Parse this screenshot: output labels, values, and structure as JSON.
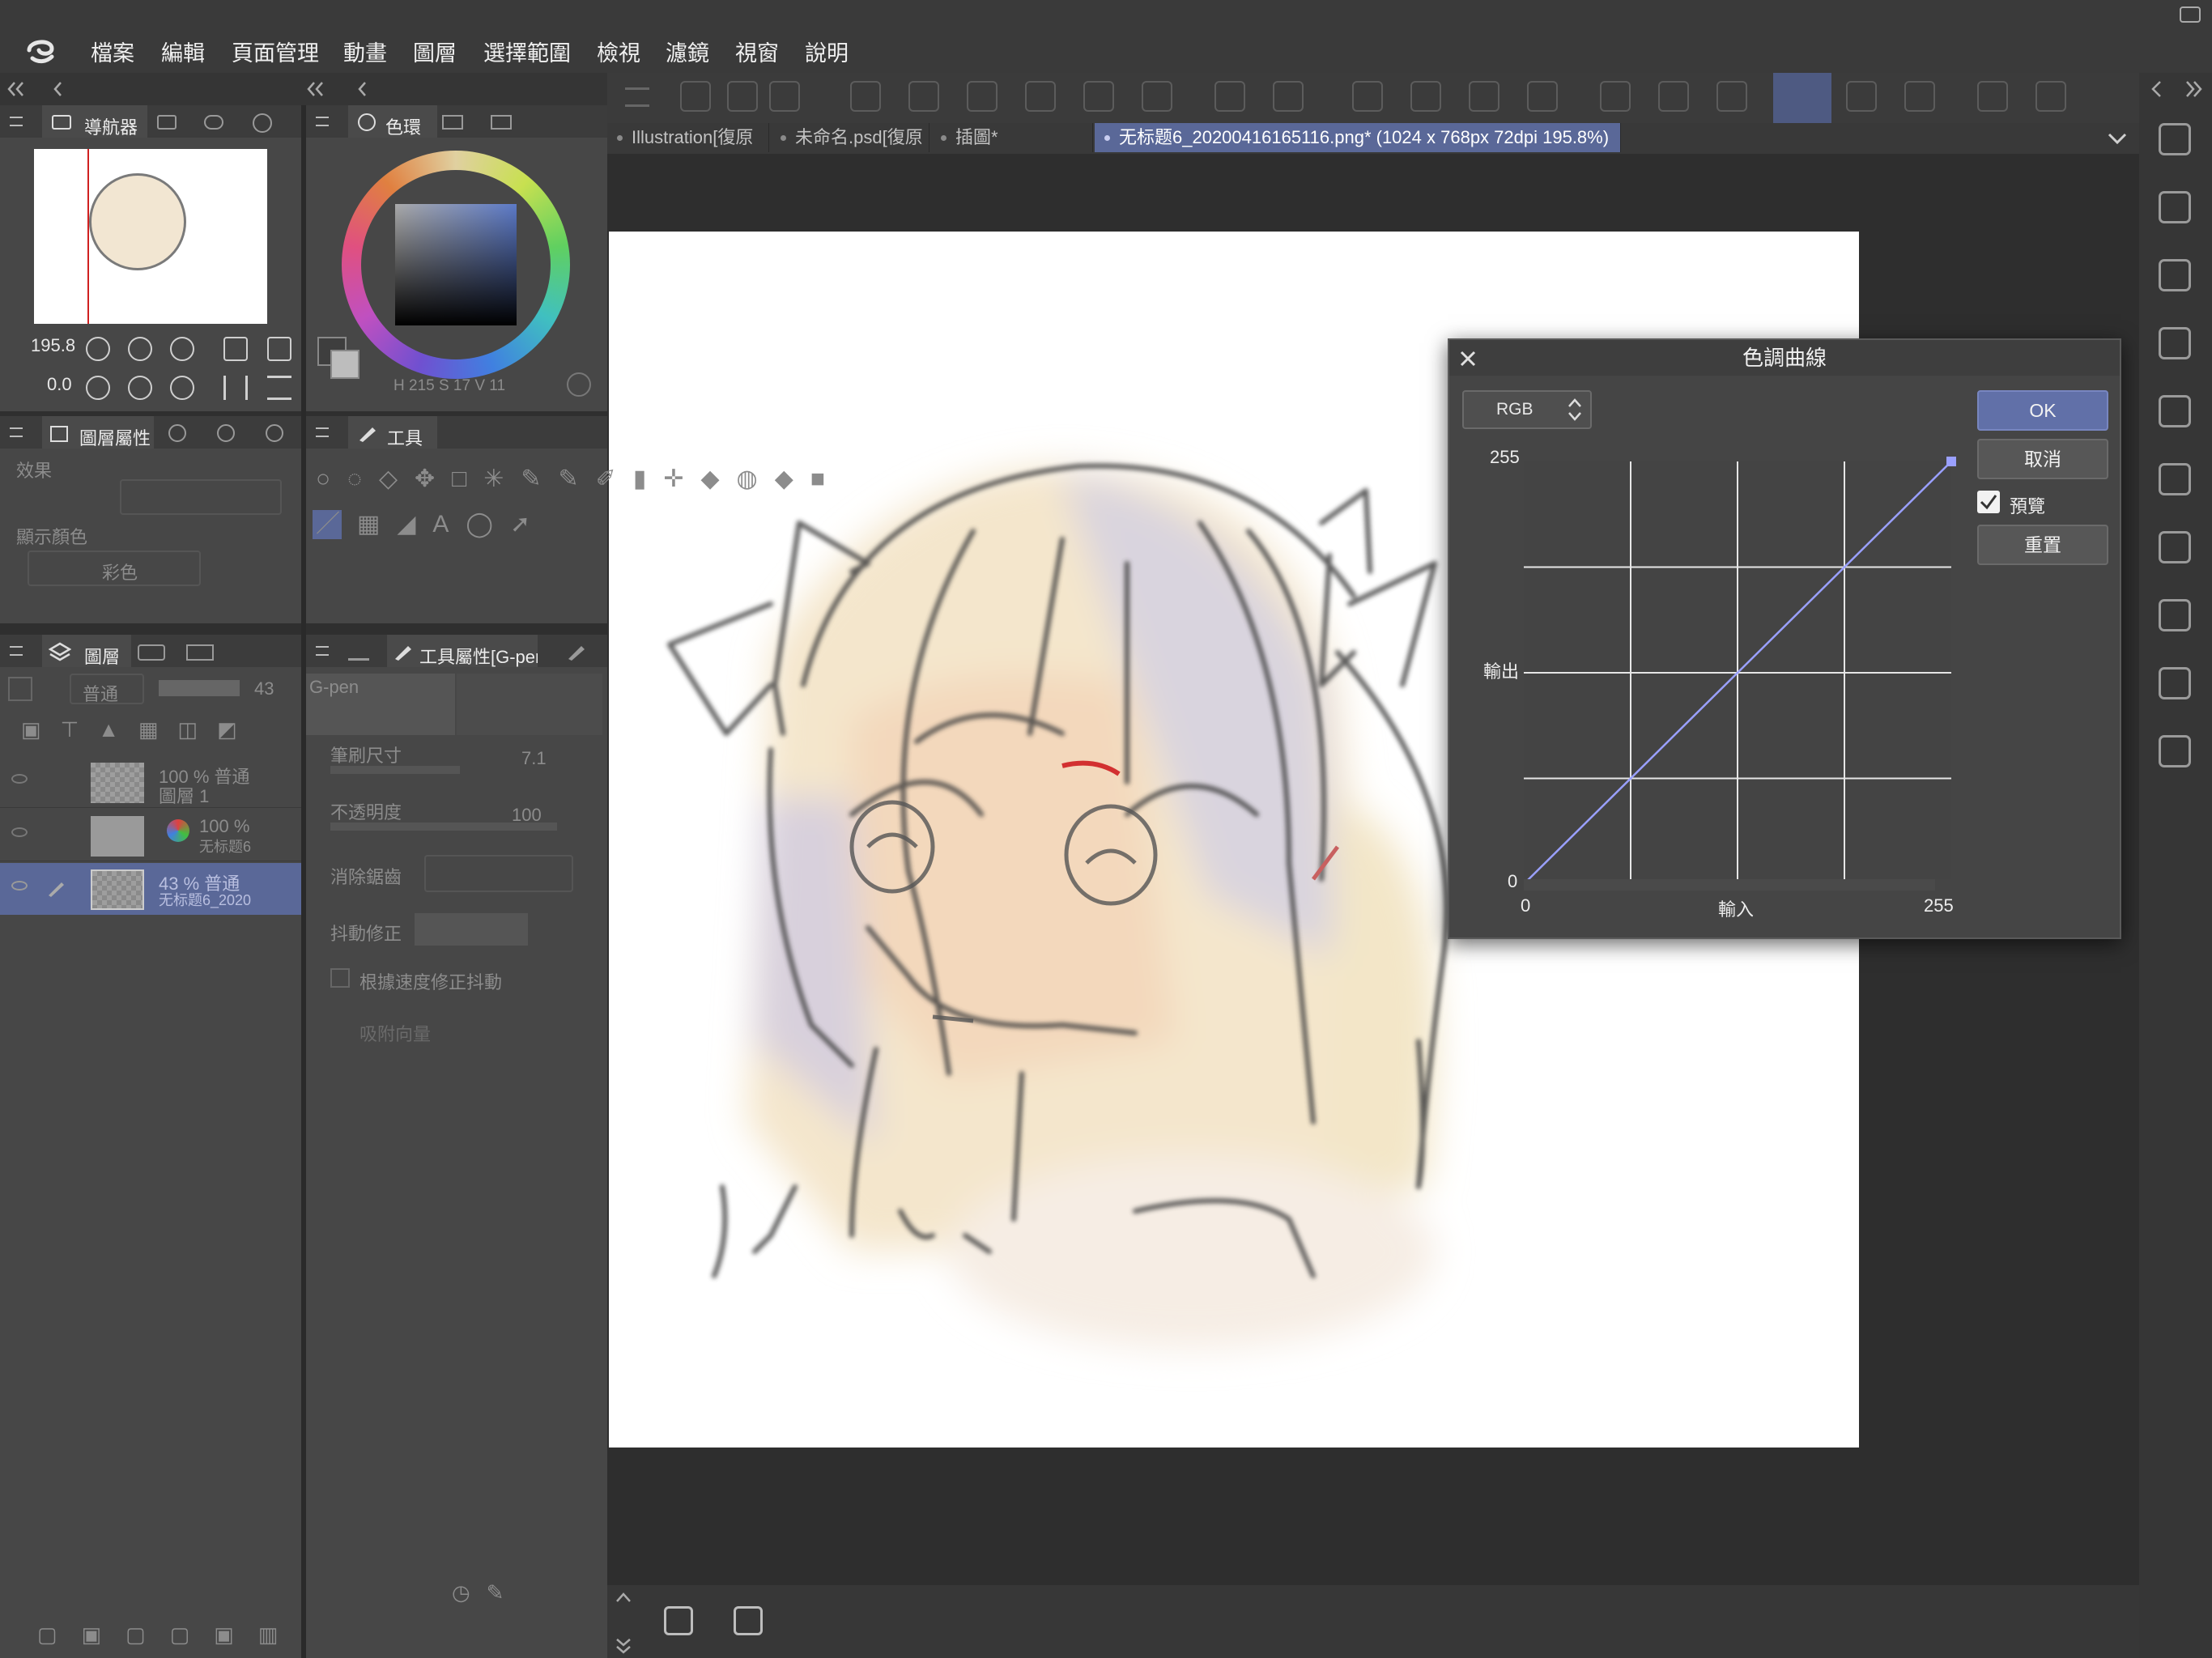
{
  "menu": [
    "檔案",
    "編輯",
    "頁面管理",
    "動畫",
    "圖層",
    "選擇範圍",
    "檢視",
    "濾鏡",
    "視窗",
    "說明"
  ],
  "tabs": [
    {
      "label": "Illustration[復原",
      "active": false
    },
    {
      "label": "未命名.psd[復原",
      "active": false
    },
    {
      "label": "插圖*",
      "active": false
    },
    {
      "label": "无标题6_20200416165116.png* (1024 x 768px 72dpi 195.8%)",
      "active": true
    }
  ],
  "navigator": {
    "tab": "導航器",
    "zoom": "195.8",
    "rotation": "0.0"
  },
  "color_panel": {
    "tab": "色環",
    "readout": "H 215  S 17  V 11"
  },
  "layer_property": {
    "tab": "圖層屬性",
    "effect_label": "效果",
    "display_color_label": "顯示顏色",
    "display_color_value": "彩色"
  },
  "tool_panel": {
    "tab": "工具"
  },
  "layers_panel": {
    "tab": "圖層",
    "blend_mode": "普通",
    "opacity_value": "43",
    "layers": [
      {
        "line1": "100 % 普通",
        "line2": "圖層 1",
        "selected": false
      },
      {
        "line1": "100 %",
        "line2": "无标题6",
        "selected": false
      },
      {
        "line1": "43 % 普通",
        "line2": "无标题6_2020",
        "selected": true
      }
    ]
  },
  "tool_property": {
    "tab": "工具屬性[G-pen",
    "preset": "G-pen",
    "brush_size_label": "筆刷尺寸",
    "brush_size_value": "7.1",
    "opacity_label": "不透明度",
    "opacity_value": "100",
    "antialias_label": "消除鋸齒",
    "stabilization_label": "抖動修正",
    "speed_label": "根據速度修正抖動",
    "snap_label": "吸附向量"
  },
  "dialog": {
    "title": "色調曲線",
    "channel": "RGB",
    "ok": "OK",
    "cancel": "取消",
    "preview": "預覽",
    "reset": "重置",
    "preview_checked": true,
    "y_max": "255",
    "y_min": "0",
    "y_label": "輸出",
    "x_min": "0",
    "x_max": "255",
    "x_label": "輸入",
    "curve_points": [
      [
        0,
        0
      ],
      [
        255,
        255
      ]
    ],
    "curve_color": "#9aa0ff"
  },
  "colors": {
    "accent": "#5a6898",
    "dialog_ok": "#6170a8"
  }
}
